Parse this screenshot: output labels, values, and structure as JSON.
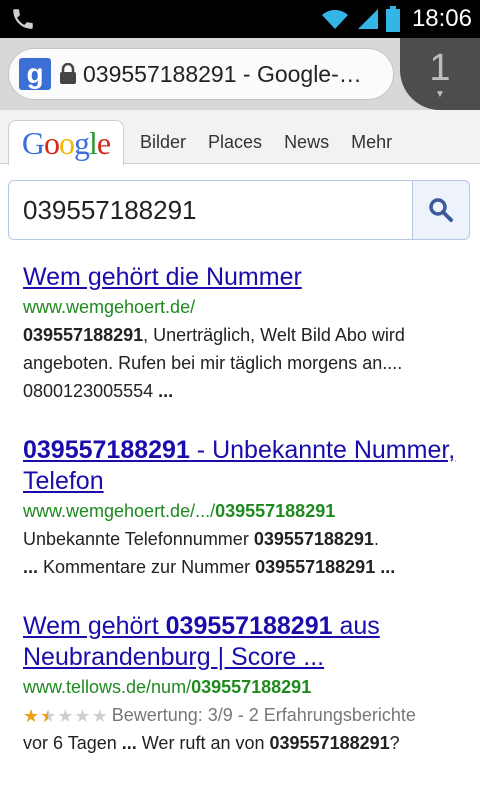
{
  "status": {
    "time": "18:06",
    "icons": [
      "phone-icon",
      "wifi-icon",
      "signal-icon",
      "battery-icon"
    ]
  },
  "browser": {
    "favicon_letter": "g",
    "page_title": "039557188291 - Google-…",
    "tab_count": "1"
  },
  "google_nav": {
    "logo": "Google",
    "links": [
      "Bilder",
      "Places",
      "News",
      "Mehr"
    ]
  },
  "search": {
    "query": "039557188291"
  },
  "results": [
    {
      "title": "Wem gehört die Nummer",
      "url": "www.wemgehoert.de/",
      "snippet_bold_1": "039557188291",
      "snippet_text_1": ", Unerträglich, Welt Bild Abo wird angeboten. Rufen bei mir täglich morgens an.... 0800123005554 ",
      "snippet_bold_2": "..."
    },
    {
      "title_bold": "039557188291",
      "title_rest": " - Unbekannte Nummer, Telefon",
      "url_plain": "www.wemgehoert.de/.../",
      "url_bold": "039557188291",
      "snippet_text_1": "Unbekannte Telefonnummer ",
      "snippet_bold_1": "039557188291",
      "snippet_text_2": ". ",
      "snippet_bold_2": "...",
      "snippet_text_3": " Kommentare zur Nummer ",
      "snippet_bold_3": "039557188291 ..."
    },
    {
      "title_pre": "Wem gehört ",
      "title_bold": "039557188291",
      "title_post": " aus Neubrandenburg | Score ...",
      "url_plain": "www.tellows.de/num/",
      "url_bold": "039557188291",
      "rating_value": 1.5,
      "rating_max": 5,
      "rating_text": "Bewertung: 3/9 - 2 Erfahrungsberichte",
      "snippet_text_1": "vor 6 Tagen ",
      "snippet_bold_1": "...",
      "snippet_text_2": " Wer ruft an von ",
      "snippet_bold_2": "039557188291",
      "snippet_text_3": "?"
    }
  ],
  "colors": {
    "link": "#1a0dab",
    "url_green": "#1e8a1e",
    "star": "#e7a11a"
  }
}
